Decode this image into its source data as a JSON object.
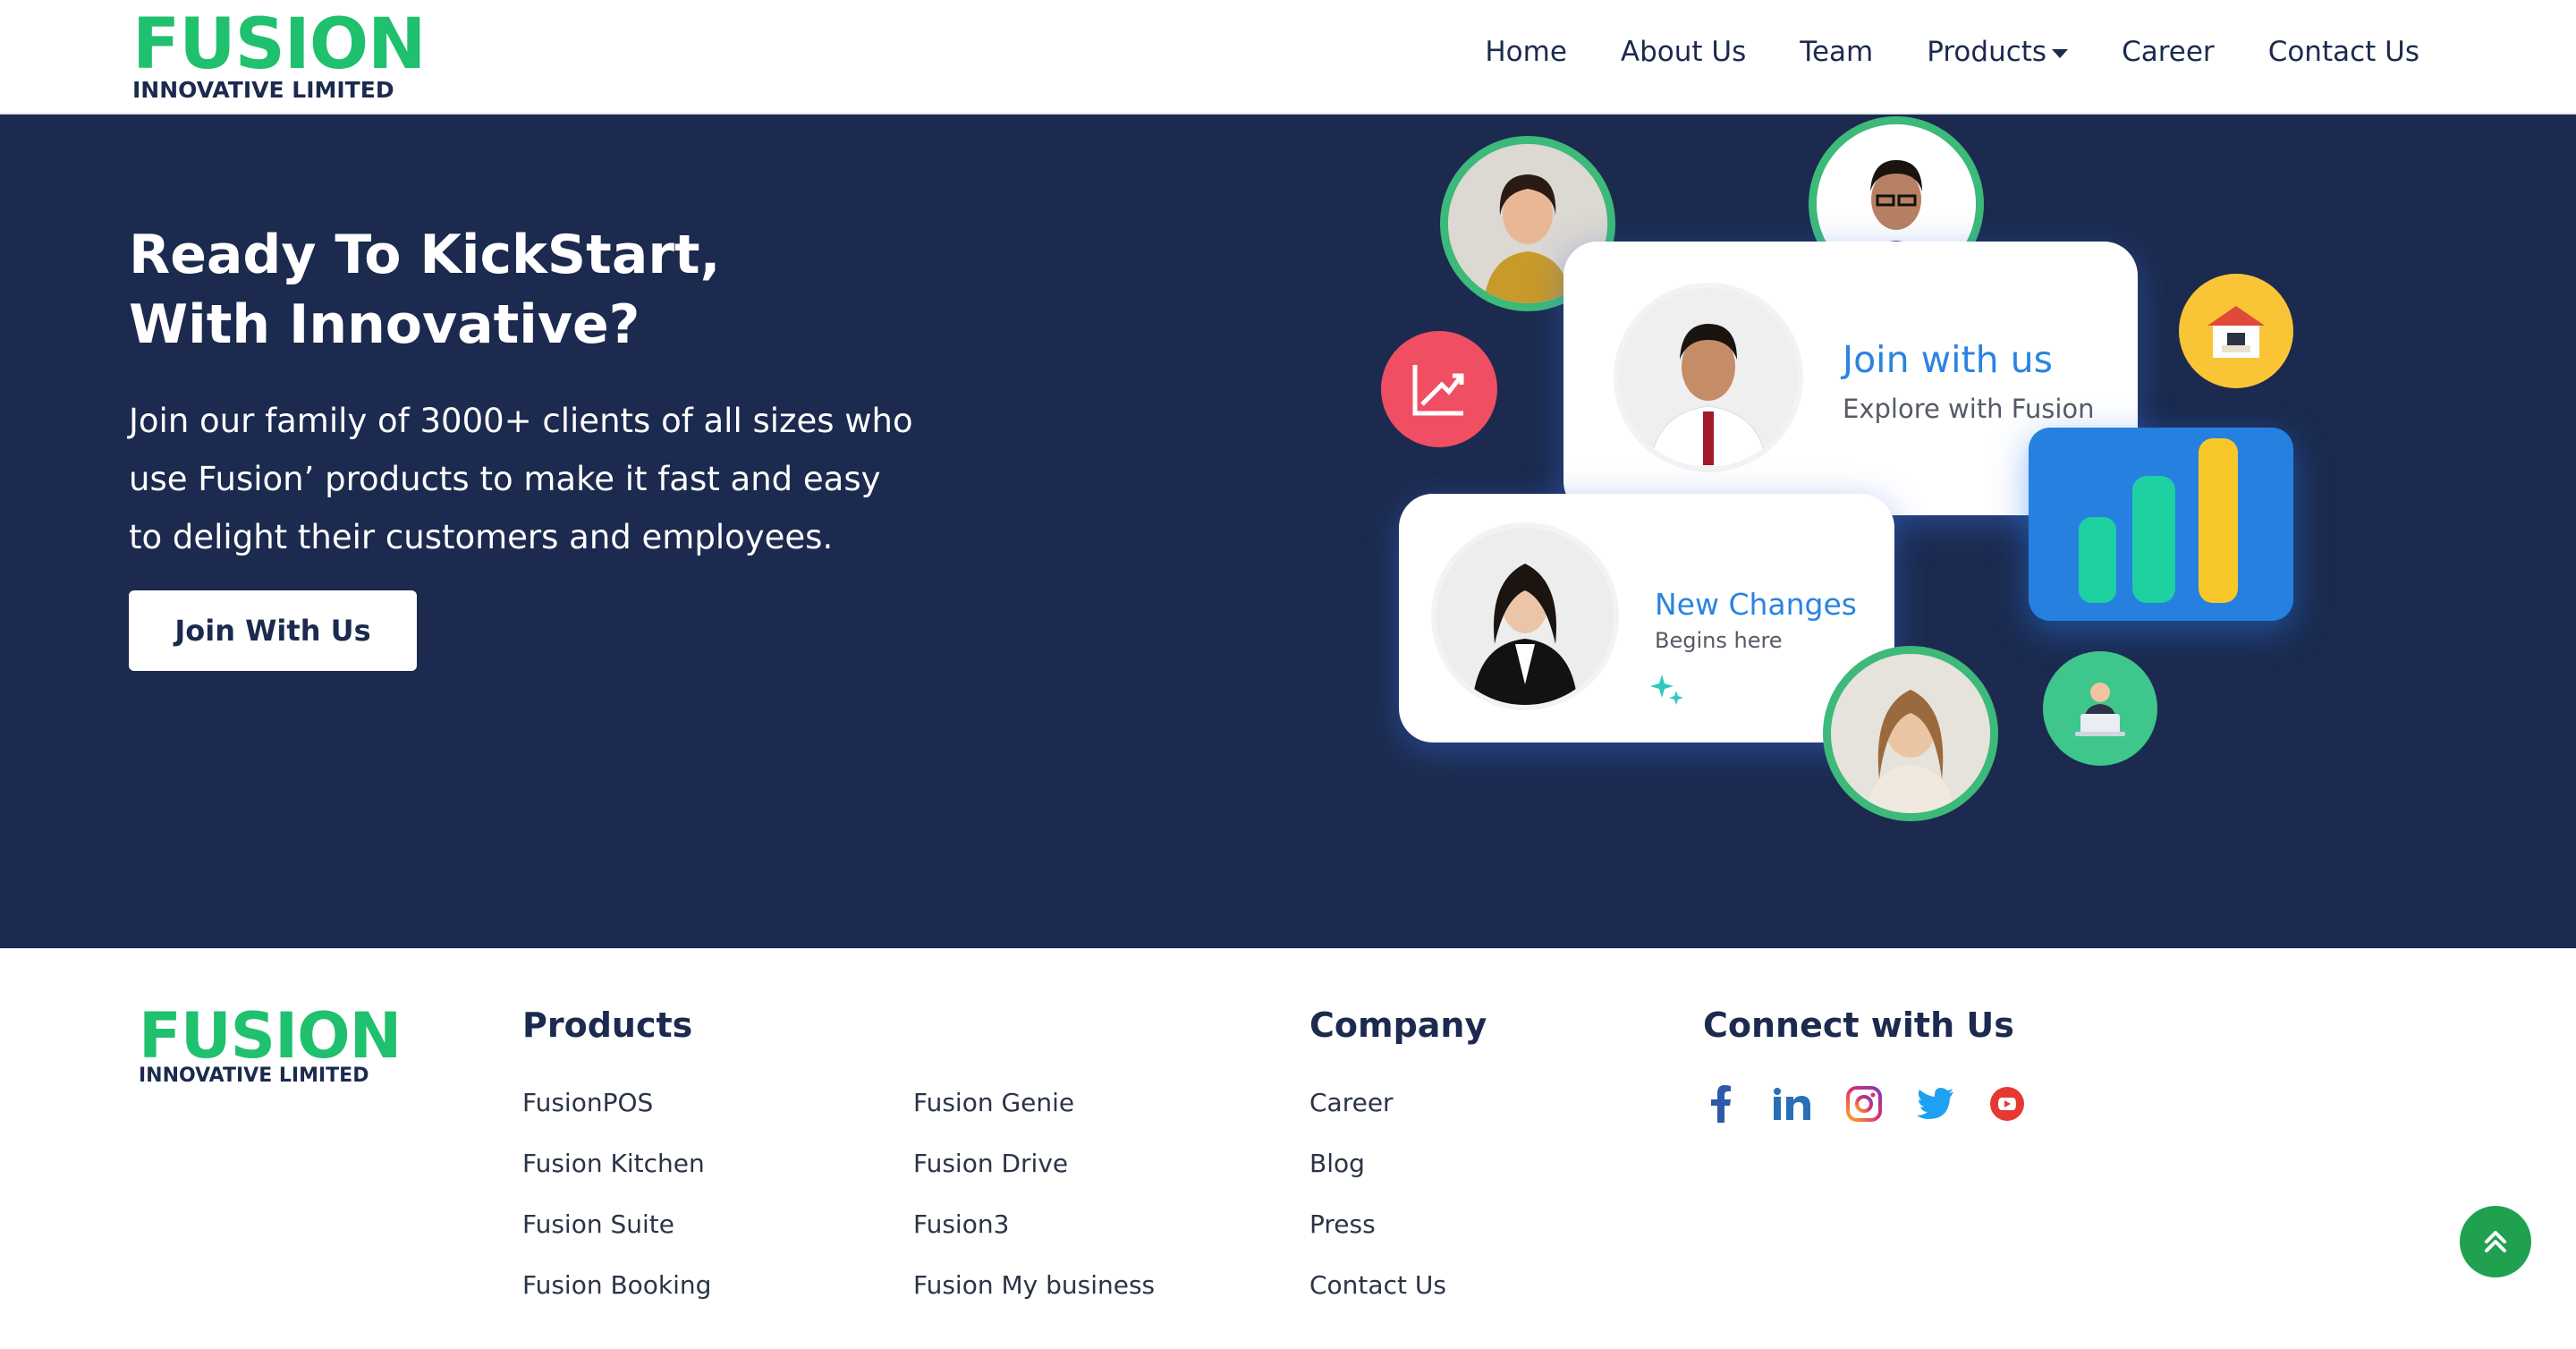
{
  "header": {
    "logo_brand": "FUSION",
    "logo_sub": "INNOVATIVE LIMITED",
    "nav": [
      {
        "label": "Home"
      },
      {
        "label": "About Us"
      },
      {
        "label": "Team"
      },
      {
        "label": "Products"
      },
      {
        "label": "Career"
      },
      {
        "label": "Contact Us"
      }
    ]
  },
  "hero": {
    "title_line1": "Ready To KickStart,",
    "title_line2": "With Innovative?",
    "text": "Join our family of 3000+ clients of all sizes who use Fusion’ products to make it fast and easy to delight their customers and employees.",
    "button_label": "Join With Us",
    "card_top_title": "Join with us",
    "card_top_sub": "Explore with Fusion",
    "card_bottom_title": "New Changes",
    "card_bottom_sub": "Begins here"
  },
  "footer": {
    "logo_brand": "FUSION",
    "logo_sub": "INNOVATIVE LIMITED",
    "products_heading": "Products",
    "products_col1": [
      "FusionPOS",
      "Fusion Kitchen",
      "Fusion Suite",
      "Fusion Booking"
    ],
    "products_col2": [
      "Fusion Genie",
      "Fusion Drive",
      "Fusion3",
      "Fusion My business"
    ],
    "company_heading": "Company",
    "company_links": [
      "Career",
      "Blog",
      "Press",
      "Contact Us"
    ],
    "connect_heading": "Connect with Us",
    "social_icons": [
      "facebook-icon",
      "linkedin-icon",
      "instagram-icon",
      "twitter-icon",
      "youtube-icon"
    ]
  },
  "colors": {
    "brand_green": "#1fc06e",
    "navy": "#1b2a4e",
    "accent_blue": "#2a84e0"
  }
}
